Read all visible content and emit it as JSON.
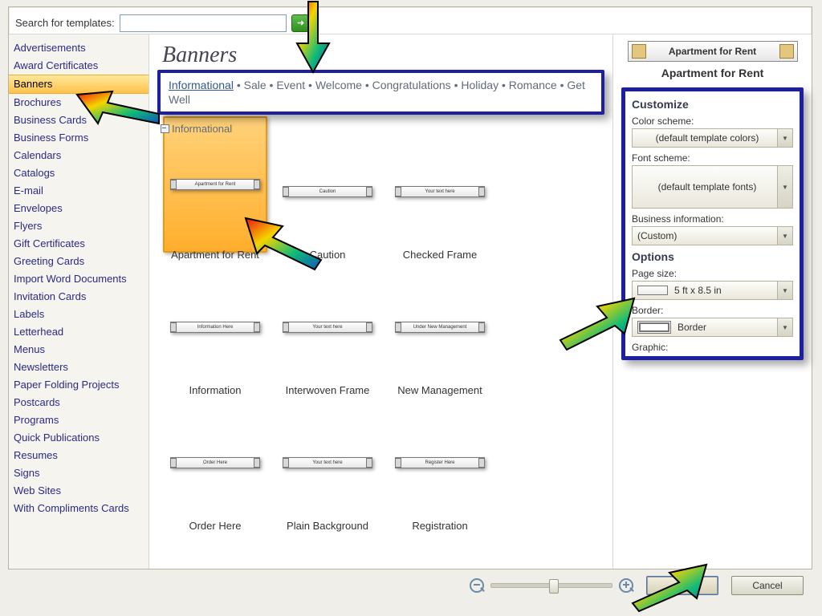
{
  "search": {
    "label": "Search for templates:",
    "value": "",
    "placeholder": ""
  },
  "categories": [
    "Advertisements",
    "Award Certificates",
    "Banners",
    "Brochures",
    "Business Cards",
    "Business Forms",
    "Calendars",
    "Catalogs",
    "E-mail",
    "Envelopes",
    "Flyers",
    "Gift Certificates",
    "Greeting Cards",
    "Import Word Documents",
    "Invitation Cards",
    "Labels",
    "Letterhead",
    "Menus",
    "Newsletters",
    "Paper Folding Projects",
    "Postcards",
    "Programs",
    "Quick Publications",
    "Resumes",
    "Signs",
    "Web Sites",
    "With Compliments Cards"
  ],
  "selected_category_index": 2,
  "center": {
    "heading": "Banners",
    "filter_categories": [
      "Informational",
      "Sale",
      "Event",
      "Welcome",
      "Congratulations",
      "Holiday",
      "Romance",
      "Get Well"
    ],
    "section": "Informational",
    "templates": [
      {
        "name": "Apartment for Rent",
        "chip": "Apartment for Rent",
        "selected": true
      },
      {
        "name": "Caution",
        "chip": "Caution",
        "selected": false
      },
      {
        "name": "Checked Frame",
        "chip": "Your text here",
        "selected": false
      },
      {
        "name": "Information",
        "chip": "Information Here",
        "selected": false
      },
      {
        "name": "Interwoven Frame",
        "chip": "Your text here",
        "selected": false
      },
      {
        "name": "New Management",
        "chip": "Under New Management",
        "selected": false
      },
      {
        "name": "Order Here",
        "chip": "Order Here",
        "selected": false
      },
      {
        "name": "Plain Background",
        "chip": "Your text here",
        "selected": false
      },
      {
        "name": "Registration",
        "chip": "Register Here",
        "selected": false
      }
    ]
  },
  "right": {
    "preview_title": "Apartment for Rent",
    "sel_name": "Apartment for Rent",
    "customize_head": "Customize",
    "color_lbl": "Color scheme:",
    "color_val": "(default template colors)",
    "font_lbl": "Font scheme:",
    "font_val": "(default template fonts)",
    "biz_lbl": "Business information:",
    "biz_val": "(Custom)",
    "options_head": "Options",
    "psize_lbl": "Page size:",
    "psize_val": "5 ft x 8.5 in",
    "border_lbl": "Border:",
    "border_val": "Border",
    "graphic_lbl": "Graphic:"
  },
  "bottom": {
    "ok": "OK",
    "cancel": "Cancel"
  }
}
